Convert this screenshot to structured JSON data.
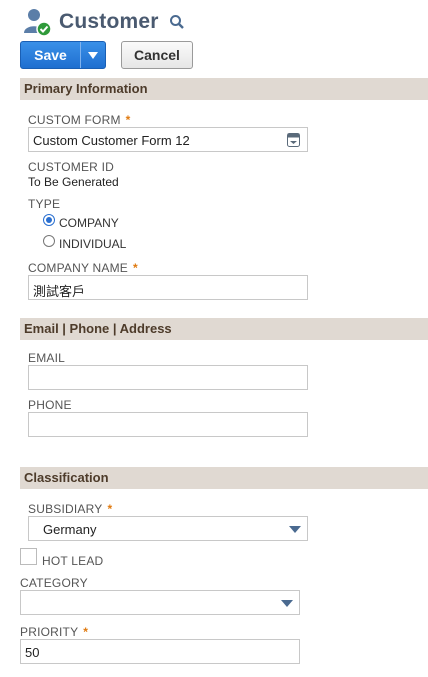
{
  "header": {
    "title": "Customer"
  },
  "toolbar": {
    "save_label": "Save",
    "cancel_label": "Cancel"
  },
  "sections": {
    "primary": "Primary Information",
    "contact": "Email | Phone | Address",
    "classification": "Classification"
  },
  "primary": {
    "custom_form_label": "CUSTOM FORM",
    "custom_form_value": "Custom Customer Form 12",
    "customer_id_label": "CUSTOMER ID",
    "customer_id_value": "To Be Generated",
    "type_label": "TYPE",
    "type_options": [
      "COMPANY",
      "INDIVIDUAL"
    ],
    "type_selected": "COMPANY",
    "company_name_label": "COMPANY NAME",
    "company_name_value": "測試客戶"
  },
  "contact": {
    "email_label": "EMAIL",
    "email_value": "",
    "phone_label": "PHONE",
    "phone_value": ""
  },
  "classification": {
    "subsidiary_label": "SUBSIDIARY",
    "subsidiary_value": "Germany",
    "hot_lead_label": "HOT LEAD",
    "hot_lead_checked": false,
    "category_label": "CATEGORY",
    "category_value": "",
    "priority_label": "PRIORITY",
    "priority_value": "50"
  },
  "required_marker": "*",
  "colors": {
    "accent": "#2a6fd0",
    "section_bg": "#e0d9d2",
    "required": "#e07a10",
    "title": "#4a5a70"
  },
  "icons": {
    "record": "customer-user-icon",
    "search": "search-icon",
    "menu": "chevron-down-icon",
    "form_picker": "form-picker-icon"
  }
}
